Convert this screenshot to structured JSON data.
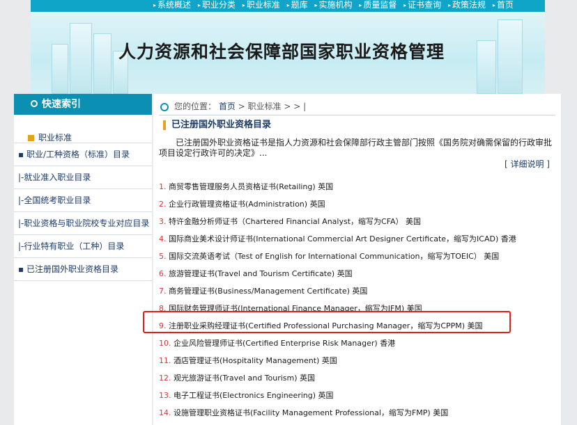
{
  "nav": [
    "系统概述",
    "职业分类",
    "职业标准",
    "题库",
    "实施机构",
    "质量监督",
    "证书查询",
    "政策法规",
    "首页"
  ],
  "banner_title": "人力资源和社会保障部国家职业资格管理",
  "sidebar": {
    "title": "快速索引",
    "category": "职业标准",
    "items": [
      "▪ 职业/工种资格（标准）目录",
      "|-就业准入职业目录",
      "|-全国统考职业目录",
      "|-职业资格与职业院校专业对应目录",
      "|-行业特有职业（工种）目录",
      "▪ 已注册国外职业资格目录"
    ]
  },
  "breadcrumb": {
    "prefix": "您的位置：",
    "home": "首页",
    "current": "职业标准",
    "tail": "> >  |"
  },
  "section_title": "已注册国外职业资格目录",
  "description": "已注册国外职业资格证书是指人力资源和社会保障部行政主管部门按照《国务院对确需保留的行政审批项目设定行政许可的决定》...",
  "detail_link": "[ 详细说明 ]",
  "certificates": [
    {
      "num": "1.",
      "text": "商贸零售管理服务人员资格证书(Retailing) 英国"
    },
    {
      "num": "2.",
      "text": "企业行政管理资格证书(Administration) 英国"
    },
    {
      "num": "3.",
      "text": "特许金融分析师证书（Chartered Financial Analyst，缩写为CFA） 美国"
    },
    {
      "num": "4.",
      "text": "国际商业美术设计师证书(International Commercial Art Designer Certificate，缩写为ICAD) 香港"
    },
    {
      "num": "5.",
      "text": "国际交流英语考试（Test of English for International Communication，缩写为TOEIC） 美国"
    },
    {
      "num": "6.",
      "text": "旅游管理证书(Travel and Tourism Certificate) 英国"
    },
    {
      "num": "7.",
      "text": "商务管理证书(Business/Management Certificate) 英国"
    },
    {
      "num": "8.",
      "text": "国际财务管理师证书(International Finance Manager，缩写为IFM) 美国"
    },
    {
      "num": "9.",
      "text": "注册职业采购经理证书(Certified Professional Purchasing Manager，缩写为CPPM) 美国"
    },
    {
      "num": "10.",
      "text": "企业风险管理师证书(Certified Enterprise Risk Manager) 香港"
    },
    {
      "num": "11.",
      "text": "酒店管理证书(Hospitality Management) 英国"
    },
    {
      "num": "12.",
      "text": "观光旅游证书(Travel and Tourism) 英国"
    },
    {
      "num": "13.",
      "text": "电子工程证书(Electronics Engineering) 英国"
    },
    {
      "num": "14.",
      "text": "设施管理职业资格证书(Facility Management Professional，缩写为FMP) 美国"
    }
  ]
}
